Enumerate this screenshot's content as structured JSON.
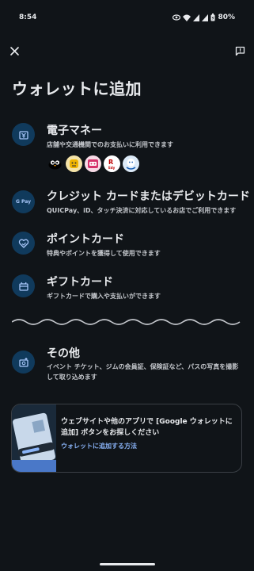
{
  "status_bar": {
    "time": "8:54",
    "battery": "80%",
    "icons": [
      "eye-icon",
      "wifi-icon",
      "signal-icon",
      "signal-icon",
      "battery-charging-icon"
    ]
  },
  "toolbar": {
    "close_icon": "close-icon",
    "feedback_icon": "feedback-icon"
  },
  "page": {
    "title": "ウォレットに追加"
  },
  "options": [
    {
      "title": "電子マネー",
      "desc": "店舗や交通機関でのお支払いに利用できます",
      "icon": "e-money-icon",
      "logos": [
        "Suica",
        "nanaco",
        "WAON",
        "楽天Edy",
        "PASMO"
      ]
    },
    {
      "title": "クレジット カードまたはデビットカード",
      "desc": "QUICPay、iD、タッチ決済に対応しているお店でご利用できます",
      "icon": "google-pay-icon",
      "icon_text": "G Pay"
    },
    {
      "title": "ポイントカード",
      "desc": "特典やポイントを獲得して使用できます",
      "icon": "loyalty-icon"
    },
    {
      "title": "ギフトカード",
      "desc": "ギフトカードで購入や支払いができます",
      "icon": "gift-card-icon"
    },
    {
      "title": "その他",
      "desc": "イベント チケット、ジムの会員証、保険証など、パスの写真を撮影して取り込めます",
      "icon": "camera-add-icon"
    }
  ],
  "promo": {
    "text": "ウェブサイトや他のアプリで [Google ウォレットに追加] ボタンをお探しください",
    "link": "ウォレットに追加する方法"
  },
  "colors": {
    "background": "#101418",
    "icon_circle": "#103a5c",
    "icon_glyph": "#a8c7fa",
    "link": "#8ab4f8"
  }
}
